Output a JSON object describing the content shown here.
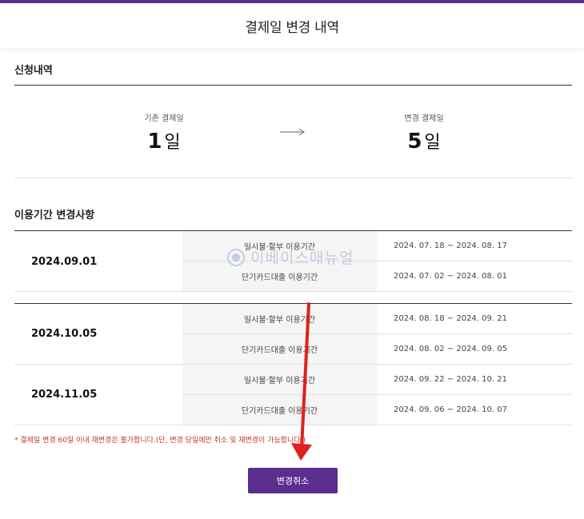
{
  "header": {
    "title": "결제일 변경 내역"
  },
  "application": {
    "title": "신청내역",
    "original": {
      "label": "기존 결제일",
      "value": "1",
      "unit": "일"
    },
    "changed": {
      "label": "변경 결제일",
      "value": "5",
      "unit": "일"
    }
  },
  "changes": {
    "title": "이용기간 변경사항",
    "groups": [
      {
        "date": "2024.09.01",
        "rows": [
          {
            "label": "일시불·할부 이용기간",
            "period": "2024. 07. 18 ~ 2024. 08. 17"
          },
          {
            "label": "단기카드대출 이용기간",
            "period": "2024. 07. 02 ~ 2024. 08. 01"
          }
        ]
      },
      {
        "date": "2024.10.05",
        "rows": [
          {
            "label": "일시불·할부 이용기간",
            "period": "2024. 08. 18 ~ 2024. 09. 21"
          },
          {
            "label": "단기카드대출 이용기간",
            "period": "2024. 08. 02 ~ 2024. 09. 05"
          }
        ]
      },
      {
        "date": "2024.11.05",
        "rows": [
          {
            "label": "일시불·할부 이용기간",
            "period": "2024. 09. 22 ~ 2024. 10. 21"
          },
          {
            "label": "단기카드대출 이용기간",
            "period": "2024. 09. 06 ~ 2024. 10. 07"
          }
        ]
      }
    ]
  },
  "watermark": {
    "text": "이베이스매뉴얼"
  },
  "notice": {
    "text": "* 결제일 변경 60일 이내 재변경은 불가합니다.(단, 변경 당일에만 취소 및 재변경이 가능합니다.)"
  },
  "actions": {
    "cancel_label": "변경취소"
  },
  "colors": {
    "accent": "#5b2d8e",
    "notice": "#c0392b",
    "annotation_arrow": "#e0201b"
  }
}
